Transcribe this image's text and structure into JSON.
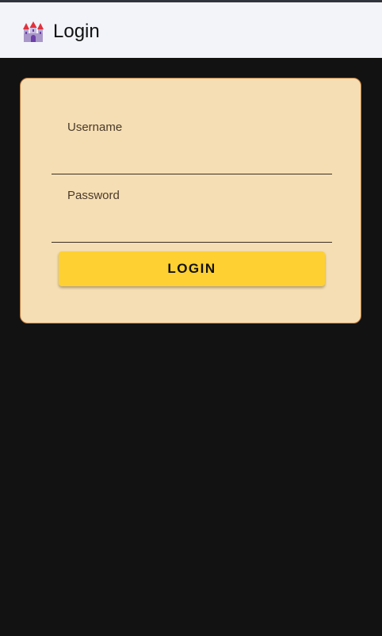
{
  "header": {
    "icon": "castle-icon",
    "title": "Login"
  },
  "form": {
    "username_label": "Username",
    "username_value": "",
    "password_label": "Password",
    "password_value": "",
    "login_button_label": "LOGIN"
  },
  "colors": {
    "page_background": "#121212",
    "header_background": "#f3f4f9",
    "card_background": "#f5deb3",
    "card_border": "#c07a3c",
    "button_background": "#ffd032"
  }
}
